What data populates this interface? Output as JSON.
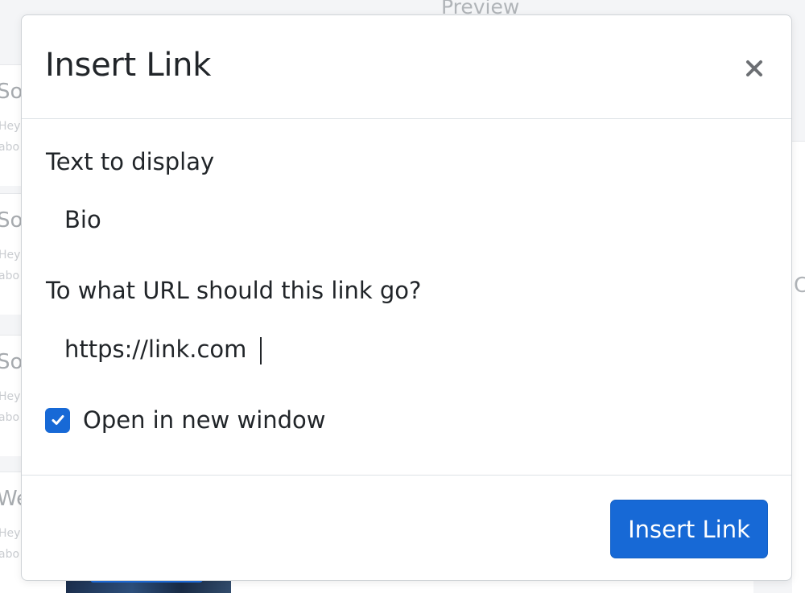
{
  "background": {
    "preview_heading": "Preview",
    "list_cards": [
      {
        "title": "So",
        "line1": "Hey",
        "line2": "abo"
      },
      {
        "title": "So",
        "line1": "Hey",
        "line2": "abo"
      },
      {
        "title": "So",
        "line1": "Hey",
        "line2": "abo"
      },
      {
        "title": "We",
        "line1": "Hey",
        "line2": "abo"
      }
    ],
    "right_letter": "C"
  },
  "modal": {
    "title": "Insert Link",
    "close_icon": "close-icon",
    "text_label": "Text to display",
    "text_value": "Bio",
    "url_label": "To what URL should this link go?",
    "url_value": "https://link.com",
    "checkbox_label": "Open in new window",
    "checkbox_checked": true,
    "submit_label": "Insert Link"
  },
  "colors": {
    "primary": "#1769d6",
    "text": "#212529",
    "close_icon": "#6c6f73",
    "divider": "#dee2e6"
  }
}
